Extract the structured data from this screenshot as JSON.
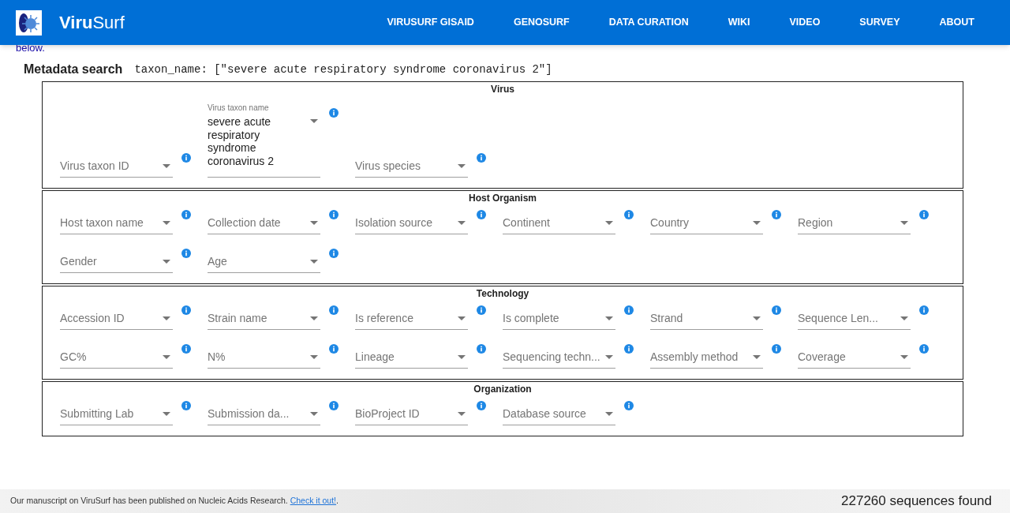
{
  "header": {
    "title": "**Viru**Surf",
    "nav": [
      "VIRUSURF GISAID",
      "GENOSURF",
      "DATA CURATION",
      "WIKI",
      "VIDEO",
      "SURVEY",
      "ABOUT"
    ]
  },
  "intro_tail": "below.",
  "metadata_search": {
    "label": "Metadata search",
    "query": "taxon_name: [\"severe acute respiratory syndrome coronavirus 2\"]"
  },
  "sections": [
    {
      "title": "Virus",
      "fields": [
        {
          "kind": "empty",
          "label": "Virus taxon ID"
        },
        {
          "kind": "filled",
          "label": "Virus taxon name",
          "value": "severe acute respiratory syndrome coronavirus 2"
        },
        {
          "kind": "empty",
          "label": "Virus species"
        }
      ]
    },
    {
      "title": "Host Organism",
      "fields": [
        {
          "kind": "empty",
          "label": "Host taxon name"
        },
        {
          "kind": "empty",
          "label": "Collection date"
        },
        {
          "kind": "empty",
          "label": "Isolation source"
        },
        {
          "kind": "empty",
          "label": "Continent"
        },
        {
          "kind": "empty",
          "label": "Country"
        },
        {
          "kind": "empty",
          "label": "Region"
        },
        {
          "kind": "empty",
          "label": "Gender"
        },
        {
          "kind": "empty",
          "label": "Age"
        }
      ]
    },
    {
      "title": "Technology",
      "fields": [
        {
          "kind": "empty",
          "label": "Accession ID"
        },
        {
          "kind": "empty",
          "label": "Strain name"
        },
        {
          "kind": "empty",
          "label": "Is reference"
        },
        {
          "kind": "empty",
          "label": "Is complete"
        },
        {
          "kind": "empty",
          "label": "Strand"
        },
        {
          "kind": "empty",
          "label": "Sequence Len..."
        },
        {
          "kind": "empty",
          "label": "GC%"
        },
        {
          "kind": "empty",
          "label": "N%"
        },
        {
          "kind": "empty",
          "label": "Lineage"
        },
        {
          "kind": "empty",
          "label": "Sequencing techn..."
        },
        {
          "kind": "empty",
          "label": "Assembly method"
        },
        {
          "kind": "empty",
          "label": "Coverage"
        }
      ]
    },
    {
      "title": "Organization",
      "fields": [
        {
          "kind": "empty",
          "label": "Submitting Lab"
        },
        {
          "kind": "empty",
          "label": "Submission da..."
        },
        {
          "kind": "empty",
          "label": "BioProject ID"
        },
        {
          "kind": "empty",
          "label": "Database source"
        }
      ]
    }
  ],
  "footer": {
    "notice": "Our manuscript on ViruSurf has been published on Nucleic Acids Research.",
    "link": "Check it out!",
    "notice_end": ".",
    "count": "227260 sequences found"
  }
}
